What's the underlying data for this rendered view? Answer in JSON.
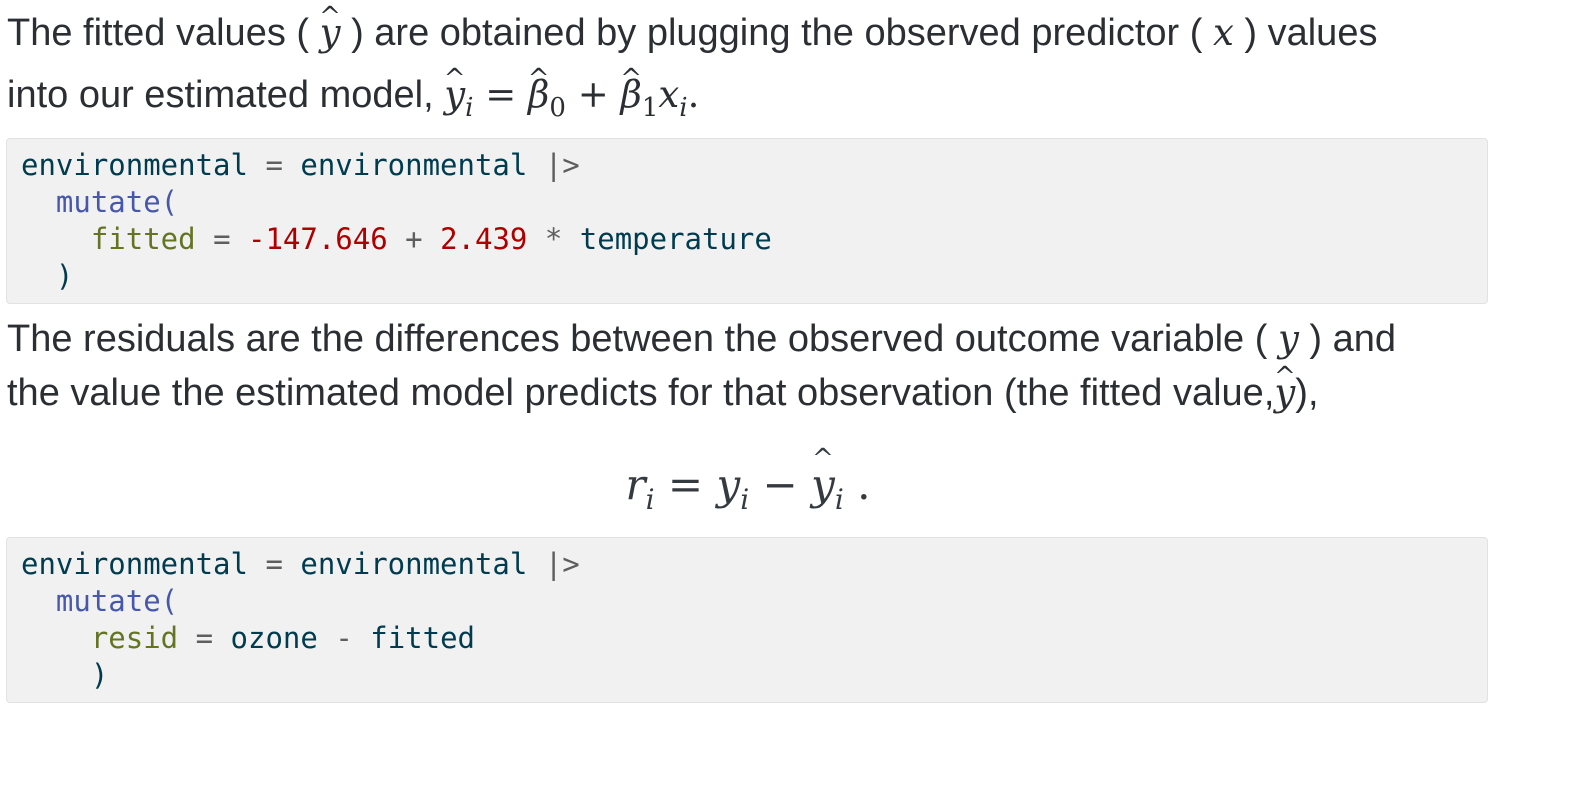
{
  "para1": {
    "part1": "The fitted values (",
    "part2": ") are obtained by plugging the observed predictor (",
    "part3": ") values",
    "part4": "into our estimated model,",
    "math_yhat": "y",
    "math_x": "x",
    "model": {
      "lhs_base": "y",
      "lhs_sub": "i",
      "eq": " = ",
      "b0": "β",
      "b0_sub": "0",
      "plus": " + ",
      "b1": "β",
      "b1_sub": "1",
      "xvar": "x",
      "x_sub": "i",
      "end": "."
    }
  },
  "code1": {
    "line1_var": "environmental",
    "line1_op": " = ",
    "line1_var2": "environmental",
    "line1_pipe": " |>",
    "line2_fn": "mutate(",
    "line3_arg": "fitted",
    "line3_eq": " = ",
    "line3_num1": "-147.646",
    "line3_plus": " + ",
    "line3_num2": "2.439",
    "line3_times": " * ",
    "line3_var": "temperature",
    "line4": ")"
  },
  "para2": {
    "line1_part1": "The residuals are the differences between the observed outcome variable (",
    "math_y": "y",
    "line1_part2": ") and",
    "line2_part1": "the value the estimated model predicts for that observation (the fitted value,",
    "math_yhat": "y",
    "line2_part2": "),"
  },
  "equation": {
    "r": "r",
    "r_sub": "i",
    "eq": " = ",
    "y": "y",
    "y_sub": "i",
    "minus": " − ",
    "yhat": "y",
    "yhat_sub": "i",
    "end": " ."
  },
  "code2": {
    "line1_var": "environmental",
    "line1_op": " = ",
    "line1_var2": "environmental",
    "line1_pipe": " |>",
    "line2_fn": "mutate(",
    "line3_arg": "resid",
    "line3_eq": " = ",
    "line3_var1": "ozone",
    "line3_minus": " - ",
    "line3_var2": "fitted",
    "line4": ")"
  }
}
